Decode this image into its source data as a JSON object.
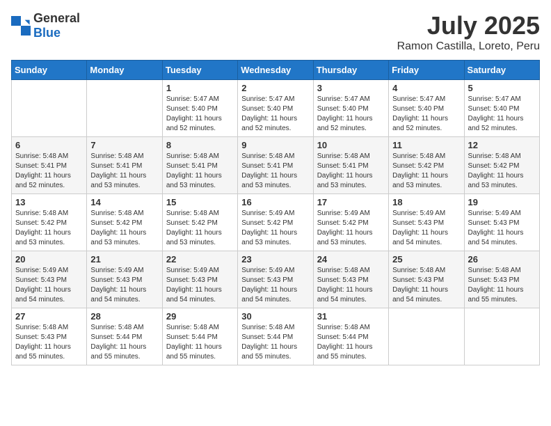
{
  "logo": {
    "general": "General",
    "blue": "Blue"
  },
  "header": {
    "month": "July 2025",
    "location": "Ramon Castilla, Loreto, Peru"
  },
  "weekdays": [
    "Sunday",
    "Monday",
    "Tuesday",
    "Wednesday",
    "Thursday",
    "Friday",
    "Saturday"
  ],
  "weeks": [
    [
      {
        "day": "",
        "info": ""
      },
      {
        "day": "",
        "info": ""
      },
      {
        "day": "1",
        "info": "Sunrise: 5:47 AM\nSunset: 5:40 PM\nDaylight: 11 hours and 52 minutes."
      },
      {
        "day": "2",
        "info": "Sunrise: 5:47 AM\nSunset: 5:40 PM\nDaylight: 11 hours and 52 minutes."
      },
      {
        "day": "3",
        "info": "Sunrise: 5:47 AM\nSunset: 5:40 PM\nDaylight: 11 hours and 52 minutes."
      },
      {
        "day": "4",
        "info": "Sunrise: 5:47 AM\nSunset: 5:40 PM\nDaylight: 11 hours and 52 minutes."
      },
      {
        "day": "5",
        "info": "Sunrise: 5:47 AM\nSunset: 5:40 PM\nDaylight: 11 hours and 52 minutes."
      }
    ],
    [
      {
        "day": "6",
        "info": "Sunrise: 5:48 AM\nSunset: 5:41 PM\nDaylight: 11 hours and 52 minutes."
      },
      {
        "day": "7",
        "info": "Sunrise: 5:48 AM\nSunset: 5:41 PM\nDaylight: 11 hours and 53 minutes."
      },
      {
        "day": "8",
        "info": "Sunrise: 5:48 AM\nSunset: 5:41 PM\nDaylight: 11 hours and 53 minutes."
      },
      {
        "day": "9",
        "info": "Sunrise: 5:48 AM\nSunset: 5:41 PM\nDaylight: 11 hours and 53 minutes."
      },
      {
        "day": "10",
        "info": "Sunrise: 5:48 AM\nSunset: 5:41 PM\nDaylight: 11 hours and 53 minutes."
      },
      {
        "day": "11",
        "info": "Sunrise: 5:48 AM\nSunset: 5:42 PM\nDaylight: 11 hours and 53 minutes."
      },
      {
        "day": "12",
        "info": "Sunrise: 5:48 AM\nSunset: 5:42 PM\nDaylight: 11 hours and 53 minutes."
      }
    ],
    [
      {
        "day": "13",
        "info": "Sunrise: 5:48 AM\nSunset: 5:42 PM\nDaylight: 11 hours and 53 minutes."
      },
      {
        "day": "14",
        "info": "Sunrise: 5:48 AM\nSunset: 5:42 PM\nDaylight: 11 hours and 53 minutes."
      },
      {
        "day": "15",
        "info": "Sunrise: 5:48 AM\nSunset: 5:42 PM\nDaylight: 11 hours and 53 minutes."
      },
      {
        "day": "16",
        "info": "Sunrise: 5:49 AM\nSunset: 5:42 PM\nDaylight: 11 hours and 53 minutes."
      },
      {
        "day": "17",
        "info": "Sunrise: 5:49 AM\nSunset: 5:42 PM\nDaylight: 11 hours and 53 minutes."
      },
      {
        "day": "18",
        "info": "Sunrise: 5:49 AM\nSunset: 5:43 PM\nDaylight: 11 hours and 54 minutes."
      },
      {
        "day": "19",
        "info": "Sunrise: 5:49 AM\nSunset: 5:43 PM\nDaylight: 11 hours and 54 minutes."
      }
    ],
    [
      {
        "day": "20",
        "info": "Sunrise: 5:49 AM\nSunset: 5:43 PM\nDaylight: 11 hours and 54 minutes."
      },
      {
        "day": "21",
        "info": "Sunrise: 5:49 AM\nSunset: 5:43 PM\nDaylight: 11 hours and 54 minutes."
      },
      {
        "day": "22",
        "info": "Sunrise: 5:49 AM\nSunset: 5:43 PM\nDaylight: 11 hours and 54 minutes."
      },
      {
        "day": "23",
        "info": "Sunrise: 5:49 AM\nSunset: 5:43 PM\nDaylight: 11 hours and 54 minutes."
      },
      {
        "day": "24",
        "info": "Sunrise: 5:48 AM\nSunset: 5:43 PM\nDaylight: 11 hours and 54 minutes."
      },
      {
        "day": "25",
        "info": "Sunrise: 5:48 AM\nSunset: 5:43 PM\nDaylight: 11 hours and 54 minutes."
      },
      {
        "day": "26",
        "info": "Sunrise: 5:48 AM\nSunset: 5:43 PM\nDaylight: 11 hours and 55 minutes."
      }
    ],
    [
      {
        "day": "27",
        "info": "Sunrise: 5:48 AM\nSunset: 5:43 PM\nDaylight: 11 hours and 55 minutes."
      },
      {
        "day": "28",
        "info": "Sunrise: 5:48 AM\nSunset: 5:44 PM\nDaylight: 11 hours and 55 minutes."
      },
      {
        "day": "29",
        "info": "Sunrise: 5:48 AM\nSunset: 5:44 PM\nDaylight: 11 hours and 55 minutes."
      },
      {
        "day": "30",
        "info": "Sunrise: 5:48 AM\nSunset: 5:44 PM\nDaylight: 11 hours and 55 minutes."
      },
      {
        "day": "31",
        "info": "Sunrise: 5:48 AM\nSunset: 5:44 PM\nDaylight: 11 hours and 55 minutes."
      },
      {
        "day": "",
        "info": ""
      },
      {
        "day": "",
        "info": ""
      }
    ]
  ]
}
